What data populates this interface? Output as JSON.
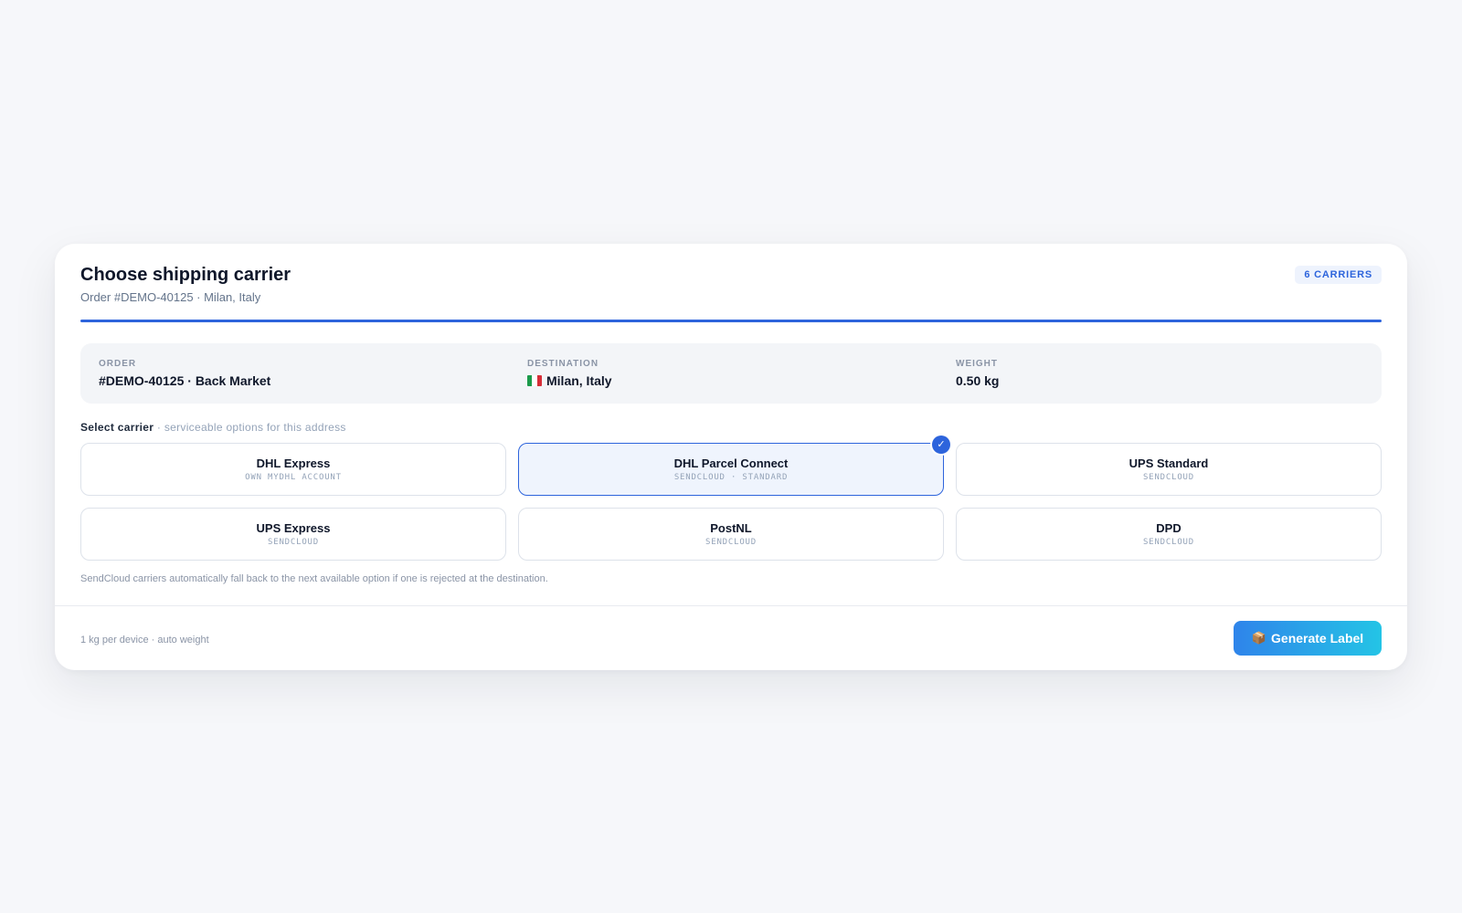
{
  "header": {
    "title": "Choose shipping carrier",
    "subtitle": "Order #DEMO-40125 · Milan, Italy",
    "badge": "6 CARRIERS"
  },
  "summary": {
    "order": {
      "label": "ORDER",
      "value": "#DEMO-40125 · Back Market"
    },
    "destination": {
      "label": "DESTINATION",
      "value": "Milan, Italy",
      "flag": "italy-flag"
    },
    "weight": {
      "label": "WEIGHT",
      "value": "0.50 kg"
    }
  },
  "selection": {
    "label": "Select carrier",
    "hint": " · serviceable options for this address",
    "selected_index": 1
  },
  "carriers": [
    {
      "name": "DHL Express",
      "sub": "OWN MYDHL ACCOUNT",
      "selected": false
    },
    {
      "name": "DHL Parcel Connect",
      "sub": "SENDCLOUD · STANDARD",
      "selected": true
    },
    {
      "name": "UPS Standard",
      "sub": "SENDCLOUD",
      "selected": false
    },
    {
      "name": "UPS Express",
      "sub": "SENDCLOUD",
      "selected": false
    },
    {
      "name": "PostNL",
      "sub": "SENDCLOUD",
      "selected": false
    },
    {
      "name": "DPD",
      "sub": "SENDCLOUD",
      "selected": false
    }
  ],
  "selected_check": "✓",
  "note": "SendCloud carriers automatically fall back to the next available option if one is rejected at the destination.",
  "footer": {
    "note": "1 kg per device · auto weight",
    "button_icon": "📦",
    "button_label": "Generate Label"
  },
  "colors": {
    "accent": "#2d64dc",
    "button_gradient_start": "#2f84ea",
    "button_gradient_end": "#24c4e6",
    "selected_bg": "#eff4fd"
  }
}
